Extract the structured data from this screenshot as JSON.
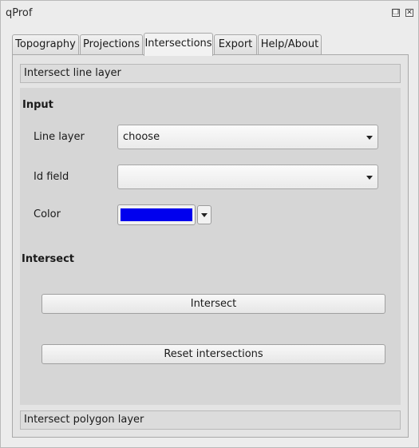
{
  "window": {
    "title": "qProf",
    "restore_icon": "restore-icon",
    "close_icon": "close-icon"
  },
  "tabs": [
    {
      "label": "Topography"
    },
    {
      "label": "Projections"
    },
    {
      "label": "Intersections",
      "active": true
    },
    {
      "label": "Export"
    },
    {
      "label": "Help/About"
    }
  ],
  "sections": {
    "line_layer_header": "Intersect line layer",
    "polygon_layer_header": "Intersect polygon layer"
  },
  "input": {
    "heading": "Input",
    "line_layer_label": "Line layer",
    "line_layer_value": "choose",
    "id_field_label": "Id field",
    "id_field_value": "",
    "color_label": "Color",
    "color_value": "#0000ee"
  },
  "intersect": {
    "heading": "Intersect",
    "intersect_button": "Intersect",
    "reset_button": "Reset intersections"
  }
}
